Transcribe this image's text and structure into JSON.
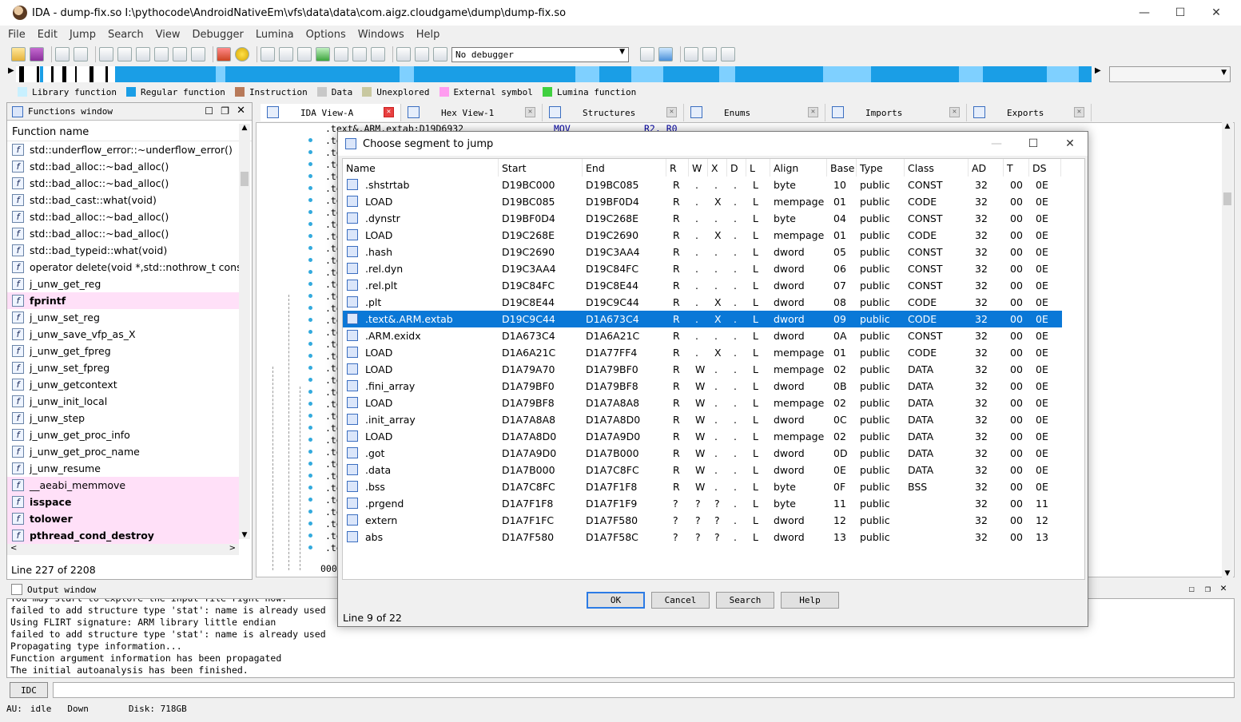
{
  "window": {
    "title": "IDA - dump-fix.so I:\\pythocode\\AndroidNativeEm\\vfs\\data\\data\\com.aigz.cloudgame\\dump\\dump-fix.so",
    "minimize": "—",
    "maximize": "☐",
    "close": "✕"
  },
  "menu": [
    "File",
    "Edit",
    "Jump",
    "Search",
    "View",
    "Debugger",
    "Lumina",
    "Options",
    "Windows",
    "Help"
  ],
  "toolbar": {
    "debugger_select": "No debugger"
  },
  "legend": [
    {
      "label": "Library function",
      "color": "#c8f0ff"
    },
    {
      "label": "Regular function",
      "color": "#1a9ee6"
    },
    {
      "label": "Instruction",
      "color": "#b87a5a"
    },
    {
      "label": "Data",
      "color": "#c8c8c8"
    },
    {
      "label": "Unexplored",
      "color": "#c8c8a0"
    },
    {
      "label": "External symbol",
      "color": "#ff9cf0"
    },
    {
      "label": "Lumina function",
      "color": "#40d040"
    }
  ],
  "functions": {
    "title": "Functions window",
    "column": "Function name",
    "items": [
      {
        "name": "std::underflow_error::~underflow_error()",
        "highlight": false,
        "bold": false
      },
      {
        "name": "std::bad_alloc::~bad_alloc()",
        "highlight": false,
        "bold": false
      },
      {
        "name": "std::bad_alloc::~bad_alloc()",
        "highlight": false,
        "bold": false
      },
      {
        "name": "std::bad_cast::what(void)",
        "highlight": false,
        "bold": false
      },
      {
        "name": "std::bad_alloc::~bad_alloc()",
        "highlight": false,
        "bold": false
      },
      {
        "name": "std::bad_alloc::~bad_alloc()",
        "highlight": false,
        "bold": false
      },
      {
        "name": "std::bad_typeid::what(void)",
        "highlight": false,
        "bold": false
      },
      {
        "name": "operator delete(void *,std::nothrow_t const&",
        "highlight": false,
        "bold": false
      },
      {
        "name": "j_unw_get_reg",
        "highlight": false,
        "bold": false
      },
      {
        "name": "fprintf",
        "highlight": true,
        "bold": true
      },
      {
        "name": "j_unw_set_reg",
        "highlight": false,
        "bold": false
      },
      {
        "name": "j_unw_save_vfp_as_X",
        "highlight": false,
        "bold": false
      },
      {
        "name": "j_unw_get_fpreg",
        "highlight": false,
        "bold": false
      },
      {
        "name": "j_unw_set_fpreg",
        "highlight": false,
        "bold": false
      },
      {
        "name": "j_unw_getcontext",
        "highlight": false,
        "bold": false
      },
      {
        "name": "j_unw_init_local",
        "highlight": false,
        "bold": false
      },
      {
        "name": "j_unw_step",
        "highlight": false,
        "bold": false
      },
      {
        "name": "j_unw_get_proc_info",
        "highlight": false,
        "bold": false
      },
      {
        "name": "j_unw_get_proc_name",
        "highlight": false,
        "bold": false
      },
      {
        "name": "j_unw_resume",
        "highlight": false,
        "bold": false
      },
      {
        "name": "__aeabi_memmove",
        "highlight": true,
        "bold": false
      },
      {
        "name": "isspace",
        "highlight": true,
        "bold": true
      },
      {
        "name": "tolower",
        "highlight": true,
        "bold": true
      },
      {
        "name": "pthread_cond_destroy",
        "highlight": true,
        "bold": true
      }
    ],
    "status": "Line 227 of 2208"
  },
  "tabs": [
    {
      "label": "IDA View-A",
      "active": true
    },
    {
      "label": "Hex View-1",
      "active": false
    },
    {
      "label": "Structures",
      "active": false
    },
    {
      "label": "Enums",
      "active": false
    },
    {
      "label": "Imports",
      "active": false
    },
    {
      "label": "Exports",
      "active": false
    }
  ],
  "disasm": {
    "first_line": ".text&.ARM.extab:D19D6932",
    "first_mnem": "MOV",
    "first_ops": "R2, R0",
    "prefix": ".te",
    "bottom": "000"
  },
  "output": {
    "title": "Output window",
    "lines": [
      "You may start to explore the input file right now.",
      "failed to add structure type 'stat': name is already used",
      "Using FLIRT signature: ARM library little endian",
      "failed to add structure type 'stat': name is already used",
      "Propagating type information...",
      "Function argument information has been propagated",
      "The initial autoanalysis has been finished."
    ],
    "idc_button": "IDC"
  },
  "status": {
    "au": "AU:",
    "state": "idle",
    "dir": "Down",
    "disk": "Disk: 718GB"
  },
  "dialog": {
    "title": "Choose segment to jump",
    "columns": [
      "Name",
      "Start",
      "End",
      "R",
      "W",
      "X",
      "D",
      "L",
      "Align",
      "Base",
      "Type",
      "Class",
      "AD",
      "T",
      "DS"
    ],
    "rows": [
      [
        ".shstrtab",
        "D19BC000",
        "D19BC085",
        "R",
        ".",
        ".",
        ".",
        "L",
        "byte",
        "10",
        "public",
        "CONST",
        "32",
        "00",
        "0E"
      ],
      [
        "LOAD",
        "D19BC085",
        "D19BF0D4",
        "R",
        ".",
        "X",
        ".",
        "L",
        "mempage",
        "01",
        "public",
        "CODE",
        "32",
        "00",
        "0E"
      ],
      [
        ".dynstr",
        "D19BF0D4",
        "D19C268E",
        "R",
        ".",
        ".",
        ".",
        "L",
        "byte",
        "04",
        "public",
        "CONST",
        "32",
        "00",
        "0E"
      ],
      [
        "LOAD",
        "D19C268E",
        "D19C2690",
        "R",
        ".",
        "X",
        ".",
        "L",
        "mempage",
        "01",
        "public",
        "CODE",
        "32",
        "00",
        "0E"
      ],
      [
        ".hash",
        "D19C2690",
        "D19C3AA4",
        "R",
        ".",
        ".",
        ".",
        "L",
        "dword",
        "05",
        "public",
        "CONST",
        "32",
        "00",
        "0E"
      ],
      [
        ".rel.dyn",
        "D19C3AA4",
        "D19C84FC",
        "R",
        ".",
        ".",
        ".",
        "L",
        "dword",
        "06",
        "public",
        "CONST",
        "32",
        "00",
        "0E"
      ],
      [
        ".rel.plt",
        "D19C84FC",
        "D19C8E44",
        "R",
        ".",
        ".",
        ".",
        "L",
        "dword",
        "07",
        "public",
        "CONST",
        "32",
        "00",
        "0E"
      ],
      [
        ".plt",
        "D19C8E44",
        "D19C9C44",
        "R",
        ".",
        "X",
        ".",
        "L",
        "dword",
        "08",
        "public",
        "CODE",
        "32",
        "00",
        "0E"
      ],
      [
        ".text&.ARM.extab",
        "D19C9C44",
        "D1A673C4",
        "R",
        ".",
        "X",
        ".",
        "L",
        "dword",
        "09",
        "public",
        "CODE",
        "32",
        "00",
        "0E"
      ],
      [
        ".ARM.exidx",
        "D1A673C4",
        "D1A6A21C",
        "R",
        ".",
        ".",
        ".",
        "L",
        "dword",
        "0A",
        "public",
        "CONST",
        "32",
        "00",
        "0E"
      ],
      [
        "LOAD",
        "D1A6A21C",
        "D1A77FF4",
        "R",
        ".",
        "X",
        ".",
        "L",
        "mempage",
        "01",
        "public",
        "CODE",
        "32",
        "00",
        "0E"
      ],
      [
        "LOAD",
        "D1A79A70",
        "D1A79BF0",
        "R",
        "W",
        ".",
        ".",
        "L",
        "mempage",
        "02",
        "public",
        "DATA",
        "32",
        "00",
        "0E"
      ],
      [
        ".fini_array",
        "D1A79BF0",
        "D1A79BF8",
        "R",
        "W",
        ".",
        ".",
        "L",
        "dword",
        "0B",
        "public",
        "DATA",
        "32",
        "00",
        "0E"
      ],
      [
        "LOAD",
        "D1A79BF8",
        "D1A7A8A8",
        "R",
        "W",
        ".",
        ".",
        "L",
        "mempage",
        "02",
        "public",
        "DATA",
        "32",
        "00",
        "0E"
      ],
      [
        ".init_array",
        "D1A7A8A8",
        "D1A7A8D0",
        "R",
        "W",
        ".",
        ".",
        "L",
        "dword",
        "0C",
        "public",
        "DATA",
        "32",
        "00",
        "0E"
      ],
      [
        "LOAD",
        "D1A7A8D0",
        "D1A7A9D0",
        "R",
        "W",
        ".",
        ".",
        "L",
        "mempage",
        "02",
        "public",
        "DATA",
        "32",
        "00",
        "0E"
      ],
      [
        ".got",
        "D1A7A9D0",
        "D1A7B000",
        "R",
        "W",
        ".",
        ".",
        "L",
        "dword",
        "0D",
        "public",
        "DATA",
        "32",
        "00",
        "0E"
      ],
      [
        ".data",
        "D1A7B000",
        "D1A7C8FC",
        "R",
        "W",
        ".",
        ".",
        "L",
        "dword",
        "0E",
        "public",
        "DATA",
        "32",
        "00",
        "0E"
      ],
      [
        ".bss",
        "D1A7C8FC",
        "D1A7F1F8",
        "R",
        "W",
        ".",
        ".",
        "L",
        "byte",
        "0F",
        "public",
        "BSS",
        "32",
        "00",
        "0E"
      ],
      [
        ".prgend",
        "D1A7F1F8",
        "D1A7F1F9",
        "?",
        "?",
        "?",
        ".",
        "L",
        "byte",
        "11",
        "public",
        "",
        "32",
        "00",
        "11"
      ],
      [
        "extern",
        "D1A7F1FC",
        "D1A7F580",
        "?",
        "?",
        "?",
        ".",
        "L",
        "dword",
        "12",
        "public",
        "",
        "32",
        "00",
        "12"
      ],
      [
        "abs",
        "D1A7F580",
        "D1A7F58C",
        "?",
        "?",
        "?",
        ".",
        "L",
        "dword",
        "13",
        "public",
        "",
        "32",
        "00",
        "13"
      ]
    ],
    "selected_index": 8,
    "buttons": {
      "ok": "OK",
      "cancel": "Cancel",
      "search": "Search",
      "help": "Help"
    },
    "status": "Line 9 of 22"
  }
}
